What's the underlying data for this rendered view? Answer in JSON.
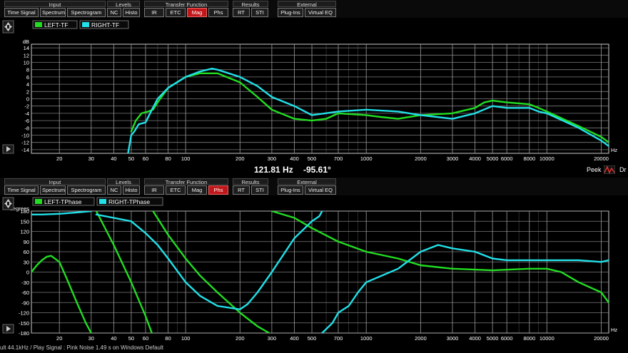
{
  "toolbar": {
    "groups": [
      {
        "title": "Input",
        "buttons": [
          "Time Signal",
          "Spectrum",
          "Spectrogram"
        ]
      },
      {
        "title": "Levels",
        "buttons": [
          "NC",
          "Histo"
        ]
      },
      {
        "title": "Transfer Function",
        "buttons": [
          "IR",
          "ETC",
          "Mag",
          "Phs"
        ]
      },
      {
        "title": "Results",
        "buttons": [
          "RT",
          "STI"
        ]
      },
      {
        "title": "External",
        "buttons": [
          "Plug-Ins",
          "Virtual EQ"
        ]
      }
    ]
  },
  "top_toolbar_active": "Mag",
  "bottom_toolbar_active": "Phs",
  "cursor_readout": {
    "freq": "121.81 Hz",
    "value": "-95.61°"
  },
  "peek_label": "Peek",
  "peek_cut": "Dr",
  "status_text": "ult 44.1kHz / Play Signal : Pink Noise  1.49 s on Windows Default",
  "colors": {
    "accent_active": "#c1171b",
    "left": "#22dd22",
    "right": "#22e0e8",
    "grid": "#9a9a9a",
    "plot_bg": "#000000"
  },
  "chart_data": [
    {
      "type": "line",
      "title": "",
      "ylabel": "dB",
      "xlabel": "Hz",
      "xscale": "log",
      "xlim": [
        14,
        22000
      ],
      "ylim": [
        -15,
        15
      ],
      "xticks": [
        20,
        30,
        40,
        50,
        60,
        80,
        100,
        200,
        300,
        400,
        500,
        700,
        1000,
        2000,
        3000,
        4000,
        5000,
        6000,
        8000,
        10000,
        20000
      ],
      "xtick_labels": [
        "20",
        "30",
        "40",
        "50",
        "60",
        "80",
        "100",
        "200",
        "300",
        "400",
        "500",
        "700",
        "1000",
        "2000",
        "3000",
        "4000",
        "5000",
        "6000",
        "8000",
        "10000",
        "20000"
      ],
      "yticks": [
        14,
        12,
        10,
        8,
        6,
        4,
        2,
        0,
        -2,
        -4,
        -6,
        -8,
        -10,
        -12,
        -14
      ],
      "ytick_labels": [
        "14",
        "12",
        "10",
        "8",
        "6",
        "4",
        "2",
        "0",
        "-2",
        "-4",
        "-6",
        "-8",
        "-10",
        "-12",
        "-14"
      ],
      "grid": true,
      "legend": "top-left",
      "series": [
        {
          "name": "LEFT-TF",
          "x": [
            50,
            53,
            57,
            62,
            66,
            70,
            80,
            100,
            120,
            150,
            200,
            250,
            300,
            400,
            500,
            600,
            700,
            1000,
            1200,
            1500,
            2000,
            3000,
            4000,
            4500,
            5000,
            6000,
            8000,
            9000,
            10000,
            15000,
            20000,
            22000
          ],
          "y": [
            -9,
            -6,
            -4,
            -3.5,
            -3,
            -1,
            3,
            6,
            7,
            7,
            4.5,
            0.5,
            -3,
            -5.5,
            -6,
            -5.5,
            -4,
            -4.5,
            -5,
            -5.5,
            -4.5,
            -4,
            -2.5,
            -1,
            -0.5,
            -1,
            -1.5,
            -2.5,
            -3.5,
            -7.5,
            -10.5,
            -12
          ]
        },
        {
          "name": "RIGHT-TF",
          "x": [
            48,
            50,
            52,
            55,
            60,
            65,
            70,
            80,
            100,
            120,
            140,
            150,
            200,
            250,
            300,
            400,
            500,
            700,
            1000,
            1500,
            2000,
            3000,
            4000,
            5000,
            6000,
            8000,
            9000,
            10000,
            15000,
            20000,
            22000
          ],
          "y": [
            -15,
            -10,
            -9,
            -7,
            -6.5,
            -3,
            0,
            3,
            6,
            7.5,
            8.3,
            8,
            6,
            3.5,
            0.5,
            -2,
            -4.5,
            -3.5,
            -3,
            -3.5,
            -4.5,
            -5.5,
            -4,
            -2,
            -2.5,
            -2.5,
            -3.5,
            -4,
            -8,
            -11.5,
            -13
          ]
        }
      ]
    },
    {
      "type": "line",
      "title": "",
      "ylabel": "degrees",
      "xlabel": "Hz",
      "xscale": "log",
      "xlim": [
        14,
        22000
      ],
      "ylim": [
        -180,
        180
      ],
      "xticks": [
        20,
        30,
        40,
        50,
        60,
        80,
        100,
        200,
        300,
        400,
        500,
        700,
        1000,
        2000,
        3000,
        4000,
        5000,
        6000,
        8000,
        10000,
        20000
      ],
      "xtick_labels": [
        "20",
        "30",
        "40",
        "50",
        "60",
        "80",
        "100",
        "200",
        "300",
        "400",
        "500",
        "700",
        "1000",
        "2000",
        "3000",
        "4000",
        "5000",
        "6000",
        "8000",
        "10000",
        "20000"
      ],
      "yticks": [
        180,
        150,
        120,
        90,
        60,
        30,
        0,
        -30,
        -60,
        -90,
        -120,
        -150,
        -180
      ],
      "ytick_labels": [
        "180",
        "150",
        "120",
        "90",
        "60",
        "30",
        "0",
        "-30",
        "-60",
        "-90",
        "-120",
        "-150",
        "-180"
      ],
      "grid": true,
      "legend": "top-left",
      "phase_wrapped": true,
      "series": [
        {
          "name": "LEFT-TPhase",
          "segments": [
            {
              "x": [
                14,
                15,
                16,
                17,
                18,
                20,
                22,
                25,
                28,
                30
              ],
              "y": [
                0,
                20,
                35,
                45,
                48,
                30,
                -20,
                -90,
                -150,
                -180
              ]
            },
            {
              "x": [
                32,
                40,
                50,
                60,
                65
              ],
              "y": [
                180,
                80,
                -30,
                -130,
                -180
              ]
            },
            {
              "x": [
                66,
                80,
                100,
                120,
                150,
                200,
                250,
                290
              ],
              "y": [
                180,
                110,
                40,
                -10,
                -60,
                -120,
                -160,
                -180
              ]
            },
            {
              "x": [
                300,
                400,
                500,
                700,
                1000,
                1500,
                2000,
                3000,
                5000,
                8000,
                10000,
                12000,
                15000,
                20000,
                22000
              ],
              "y": [
                180,
                160,
                130,
                90,
                60,
                40,
                20,
                10,
                5,
                10,
                10,
                0,
                -30,
                -60,
                -90
              ]
            }
          ]
        },
        {
          "name": "RIGHT-TPhase",
          "segments": [
            {
              "x": [
                14,
                16,
                20,
                25,
                30
              ],
              "y": [
                170,
                170,
                172,
                176,
                180
              ]
            },
            {
              "x": [
                32,
                40,
                50,
                60,
                70,
                80,
                100,
                120,
                150,
                200,
                220,
                250,
                300,
                400,
                500,
                550,
                570
              ],
              "y": [
                170,
                160,
                150,
                115,
                80,
                40,
                -30,
                -70,
                -100,
                -110,
                -95,
                -60,
                0,
                100,
                150,
                165,
                180
              ]
            },
            {
              "x": [
                570,
                650,
                700,
                800,
                900,
                1000,
                1500,
                2000,
                2500,
                3000,
                4000,
                5000,
                6000,
                8000,
                10000,
                15000,
                20000,
                22000
              ],
              "y": [
                -180,
                -150,
                -120,
                -100,
                -60,
                -30,
                10,
                60,
                80,
                70,
                60,
                40,
                35,
                35,
                35,
                35,
                30,
                35
              ]
            }
          ]
        }
      ]
    }
  ]
}
